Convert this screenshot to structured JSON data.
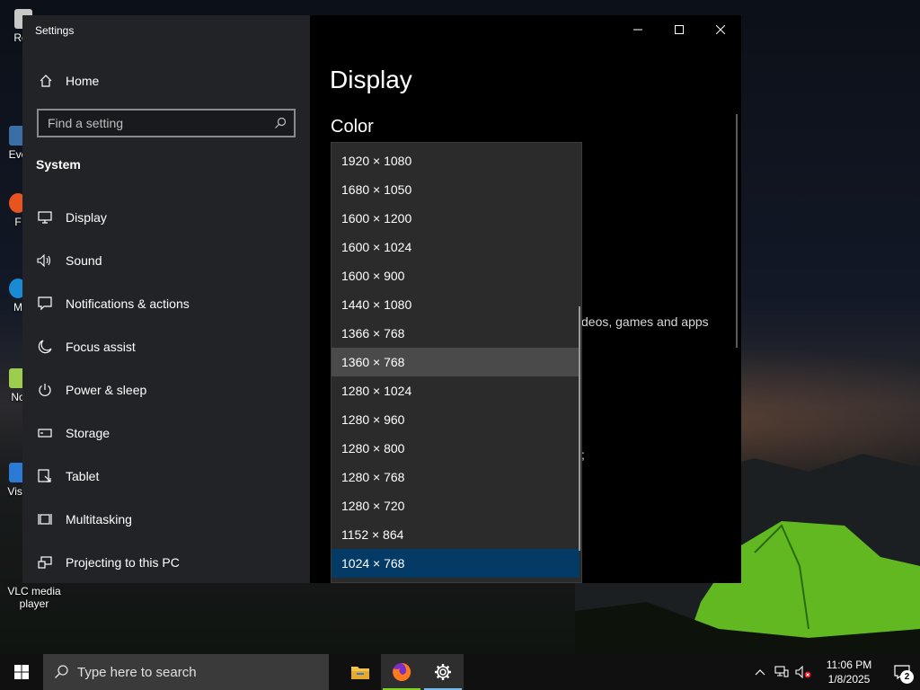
{
  "desktop": {
    "icons": [
      {
        "label": "Rec",
        "name": "desktop-icon-recycle-bin"
      },
      {
        "label": "Eve",
        "name": "desktop-icon-eve"
      },
      {
        "label": "F",
        "name": "desktop-icon-f"
      },
      {
        "label": "M",
        "name": "desktop-icon-m"
      },
      {
        "label": "No",
        "name": "desktop-icon-no"
      },
      {
        "label": "Visu",
        "name": "desktop-icon-visu"
      },
      {
        "label": "VLC media player",
        "name": "desktop-icon-vlc"
      }
    ]
  },
  "window": {
    "title": "Settings",
    "home_label": "Home",
    "search_placeholder": "Find a setting",
    "section_heading": "System",
    "nav_items": [
      {
        "label": "Display",
        "icon": "display-icon"
      },
      {
        "label": "Sound",
        "icon": "sound-icon"
      },
      {
        "label": "Notifications & actions",
        "icon": "notifications-icon"
      },
      {
        "label": "Focus assist",
        "icon": "moon-icon"
      },
      {
        "label": "Power & sleep",
        "icon": "power-icon"
      },
      {
        "label": "Storage",
        "icon": "storage-icon"
      },
      {
        "label": "Tablet",
        "icon": "tablet-icon"
      },
      {
        "label": "Multitasking",
        "icon": "multitasking-icon"
      },
      {
        "label": "Projecting to this PC",
        "icon": "projecting-icon"
      }
    ]
  },
  "content": {
    "page_title": "Display",
    "subtitle": "Color",
    "partial_text_1": "deos, games and apps",
    "partial_text_2": ";",
    "partial_text_3": "\\",
    "resolution_options": [
      "1920 × 1080",
      "1680 × 1050",
      "1600 × 1200",
      "1600 × 1024",
      "1600 × 900",
      "1440 × 1080",
      "1366 × 768",
      "1360 × 768",
      "1280 × 1024",
      "1280 × 960",
      "1280 × 800",
      "1280 × 768",
      "1280 × 720",
      "1152 × 864",
      "1024 × 768"
    ],
    "hovered_option": "1360 × 768",
    "selected_option": "1024 × 768"
  },
  "taskbar": {
    "search_placeholder": "Type here to search",
    "time": "11:06 PM",
    "date": "1/8/2025",
    "notification_count": "2"
  },
  "colors": {
    "accent_selected": "#033a66",
    "hover": "#4a4a4a",
    "taskbar_active": "#76b9ed"
  }
}
